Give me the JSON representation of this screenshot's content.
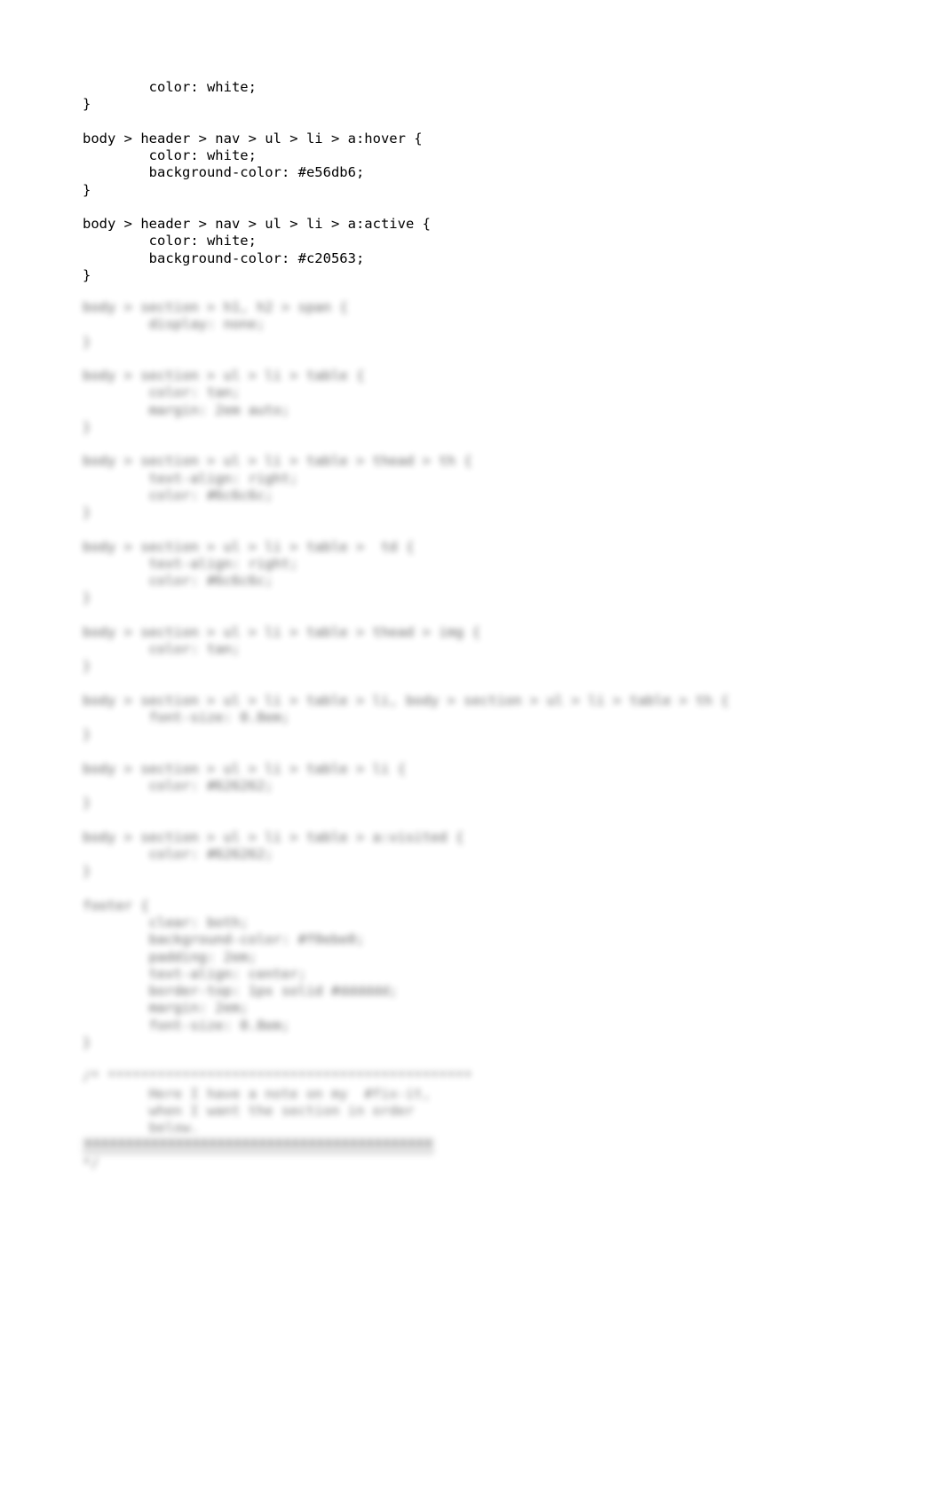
{
  "document": {
    "kind": "css-source-text",
    "background_color": "#ffffff",
    "text_color": "#000000",
    "blurred_text_color": "#2e2e2e",
    "highlight_color": "#d8d8d8"
  },
  "palette": {
    "hover_background": "#e56db6",
    "active_background": "#c20563"
  },
  "sharp_code": {
    "lines": [
      "        color: white;",
      "}",
      "",
      "body > header > nav > ul > li > a:hover {",
      "        color: white;",
      "        background-color: #e56db6;",
      "}",
      "",
      "body > header > nav > ul > li > a:active {",
      "        color: white;",
      "        background-color: #c20563;",
      "}"
    ]
  },
  "blurred_code": {
    "note": "Continuation of the stylesheet; rendered out of focus in the screenshot.",
    "lines": [
      {
        "text": "body > section > h1, h2 > span {",
        "style": "normal"
      },
      {
        "text": "        display: none;",
        "style": "normal"
      },
      {
        "text": "}",
        "style": "normal"
      },
      {
        "text": "",
        "style": "blank"
      },
      {
        "text": "body > section > ul > li > table {",
        "style": "normal"
      },
      {
        "text": "        color: tan;",
        "style": "normal"
      },
      {
        "text": "        margin: 2em auto;",
        "style": "normal"
      },
      {
        "text": "}",
        "style": "normal"
      },
      {
        "text": "",
        "style": "blank"
      },
      {
        "text": "body > section > ul > li > table > thead > th {",
        "style": "normal"
      },
      {
        "text": "        text-align: right;",
        "style": "normal"
      },
      {
        "text": "        color: #6c6c6c;",
        "style": "normal"
      },
      {
        "text": "}",
        "style": "normal"
      },
      {
        "text": "",
        "style": "blank"
      },
      {
        "text": "body > section > ul > li > table >  td {",
        "style": "normal"
      },
      {
        "text": "        text-align: right;",
        "style": "normal"
      },
      {
        "text": "        color: #6c6c6c;",
        "style": "normal"
      },
      {
        "text": "}",
        "style": "normal"
      },
      {
        "text": "",
        "style": "blank"
      },
      {
        "text": "body > section > ul > li > table > thead > img {",
        "style": "normal"
      },
      {
        "text": "        color: tan;",
        "style": "normal"
      },
      {
        "text": "}",
        "style": "normal"
      },
      {
        "text": "",
        "style": "blank"
      },
      {
        "text": "body > section > ul > li > table > li, body > section > ul > li > table > th {",
        "style": "normal"
      },
      {
        "text": "        font-size: 0.8em;",
        "style": "normal"
      },
      {
        "text": "}",
        "style": "normal"
      },
      {
        "text": "",
        "style": "blank"
      },
      {
        "text": "body > section > ul > li > table > li {",
        "style": "normal"
      },
      {
        "text": "        color: #626262;",
        "style": "normal"
      },
      {
        "text": "}",
        "style": "normal"
      },
      {
        "text": "",
        "style": "blank"
      },
      {
        "text": "body > section > ul > li > table > a:visited {",
        "style": "normal"
      },
      {
        "text": "        color: #626262;",
        "style": "normal"
      },
      {
        "text": "}",
        "style": "normal"
      },
      {
        "text": "",
        "style": "blank"
      },
      {
        "text": "footer {",
        "style": "normal"
      },
      {
        "text": "        clear: both;",
        "style": "normal"
      },
      {
        "text": "        background-color: #f0ebe0;",
        "style": "normal"
      },
      {
        "text": "        padding: 2em;",
        "style": "normal"
      },
      {
        "text": "        text-align: center;",
        "style": "normal"
      },
      {
        "text": "        border-top: 1px solid #dddddd;",
        "style": "normal"
      },
      {
        "text": "        margin: 2em;",
        "style": "normal"
      },
      {
        "text": "        font-size: 0.8em;",
        "style": "normal"
      },
      {
        "text": "}",
        "style": "normal"
      },
      {
        "text": "",
        "style": "blank"
      },
      {
        "text": "/* ********************************************",
        "style": "comment"
      },
      {
        "text": "        Here I have a note on my  #fix-it,",
        "style": "comment"
      },
      {
        "text": "        when I want the section in order",
        "style": "comment"
      },
      {
        "text": "        below.",
        "style": "comment"
      },
      {
        "text": "******************************************",
        "style": "selected"
      },
      {
        "text": "*/",
        "style": "comment"
      }
    ]
  }
}
